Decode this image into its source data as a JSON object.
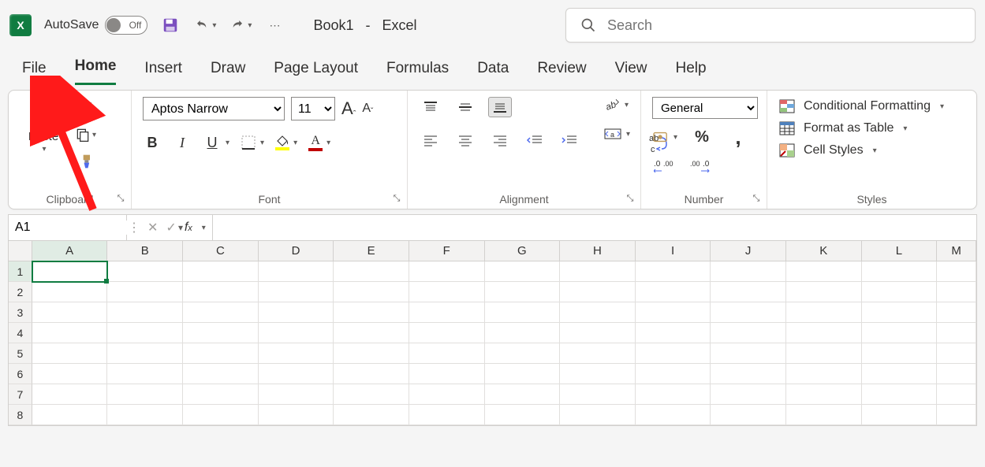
{
  "titlebar": {
    "autosave_label": "AutoSave",
    "autosave_state": "Off",
    "document_name": "Book1",
    "app_name": "Excel",
    "title_sep": "-"
  },
  "search": {
    "placeholder": "Search"
  },
  "tabs": [
    "File",
    "Home",
    "Insert",
    "Draw",
    "Page Layout",
    "Formulas",
    "Data",
    "Review",
    "View",
    "Help"
  ],
  "active_tab": "Home",
  "clipboard": {
    "paste_label": "Paste",
    "group_label": "Clipboard"
  },
  "font": {
    "name": "Aptos Narrow",
    "size": "11",
    "group_label": "Font",
    "highlight_color": "#ffff00",
    "font_color": "#c00000"
  },
  "alignment": {
    "group_label": "Alignment"
  },
  "number": {
    "format": "General",
    "group_label": "Number"
  },
  "styles": {
    "conditional": "Conditional Formatting",
    "table": "Format as Table",
    "cell": "Cell Styles",
    "group_label": "Styles"
  },
  "namebox": {
    "value": "A1"
  },
  "grid": {
    "columns": [
      "A",
      "B",
      "C",
      "D",
      "E",
      "F",
      "G",
      "H",
      "I",
      "J",
      "K",
      "L",
      "M"
    ],
    "rows": [
      1,
      2,
      3,
      4,
      5,
      6,
      7,
      8
    ],
    "active_cell": "A1"
  },
  "annotation": {
    "points_to": "File tab"
  }
}
